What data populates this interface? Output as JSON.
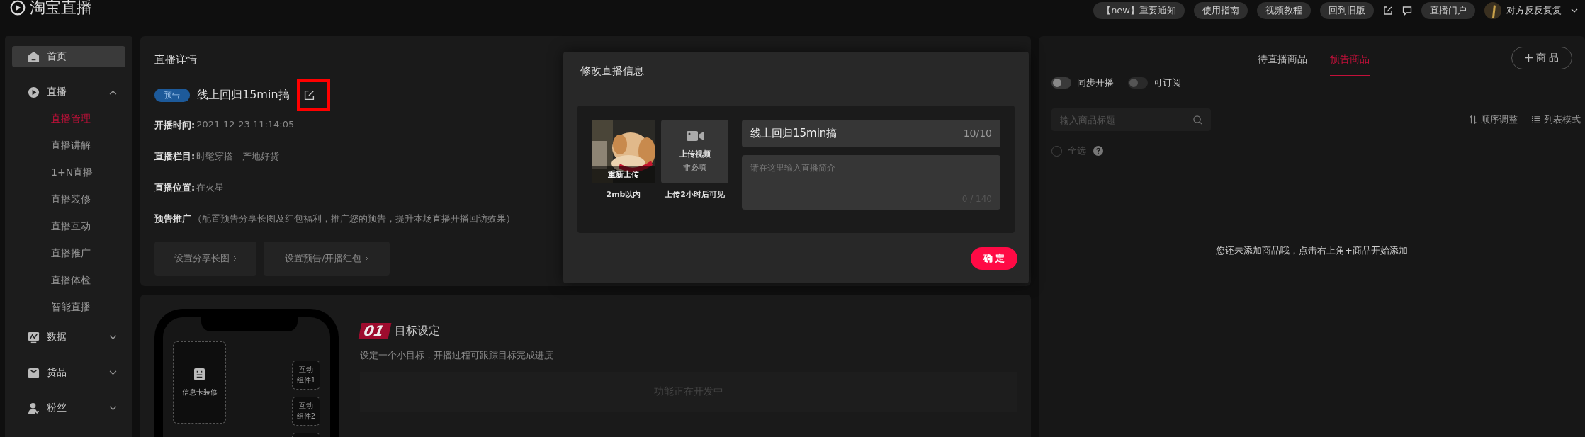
{
  "header": {
    "logo": "淘宝直播",
    "buttons": [
      "【new】重要通知",
      "使用指南",
      "视频教程",
      "回到旧版"
    ],
    "portal_button": "直播门户",
    "username": "对方反反复复"
  },
  "sidebar": {
    "items": [
      {
        "label": "首页",
        "selected": true
      },
      {
        "label": "直播",
        "selected": false,
        "expanded": true,
        "children": [
          {
            "label": "直播管理",
            "selected": true
          },
          {
            "label": "直播讲解",
            "selected": false
          },
          {
            "label": "1+N直播",
            "selected": false
          },
          {
            "label": "直播装修",
            "selected": false
          },
          {
            "label": "直播互动",
            "selected": false
          },
          {
            "label": "直播推广",
            "selected": false
          },
          {
            "label": "直播体检",
            "selected": false
          },
          {
            "label": "智能直播",
            "selected": false
          }
        ]
      },
      {
        "label": "数据",
        "selected": false,
        "expanded": false
      },
      {
        "label": "货品",
        "selected": false,
        "expanded": false
      },
      {
        "label": "粉丝",
        "selected": false,
        "expanded": false
      }
    ]
  },
  "detail": {
    "title": "直播详情",
    "badge": "预告",
    "live_title": "线上回归15min搞",
    "fields": [
      {
        "label": "开播时间:",
        "value": "2021-12-23 11:14:05"
      },
      {
        "label": "直播栏目:",
        "value": "时髦穿搭 - 产地好货"
      },
      {
        "label": "直播位置:",
        "value": "在火星"
      }
    ],
    "promo": {
      "label": "预告推广",
      "note": "（配置预告分享长图及红包福利，推广您的预告，提升本场直播开播回访效果）"
    },
    "buttons": [
      "设置分享长图",
      "设置预告/开播红包"
    ]
  },
  "goal": {
    "number": "01",
    "title": "目标设定",
    "description": "设定一个小目标，开播过程可跟踪目标完成进度",
    "status": "功能正在开发中",
    "phone": {
      "card": "信息卡装修",
      "widgets": [
        "互动组件1",
        "互动组件2"
      ]
    }
  },
  "modal": {
    "title": "修改直播信息",
    "cover": {
      "kind": "picture",
      "overlay": "重新上传",
      "note": "2mb以内"
    },
    "video": {
      "label": "上传视频",
      "hint": "非必填",
      "note": "上传2小时后可见"
    },
    "title_field": {
      "value": "线上回归15min搞",
      "counter": "10/10"
    },
    "intro_field": {
      "placeholder": "请在这里输入直播简介",
      "counter": "0 / 140"
    },
    "confirm": "确 定"
  },
  "products": {
    "tabs": [
      {
        "label": "待直播商品",
        "selected": false
      },
      {
        "label": "预告商品",
        "selected": true
      }
    ],
    "add_button": "商 品",
    "toggles": [
      {
        "label": "同步开播",
        "on": false,
        "disabled": false
      },
      {
        "label": "可订阅",
        "on": false,
        "disabled": true
      }
    ],
    "search": {
      "placeholder": "输入商品标题"
    },
    "actions": [
      "顺序调整",
      "列表模式"
    ],
    "select_all": {
      "label": "全选",
      "checked": false
    },
    "empty": "您还未添加商品哦，点击右上角+商品开始添加"
  }
}
